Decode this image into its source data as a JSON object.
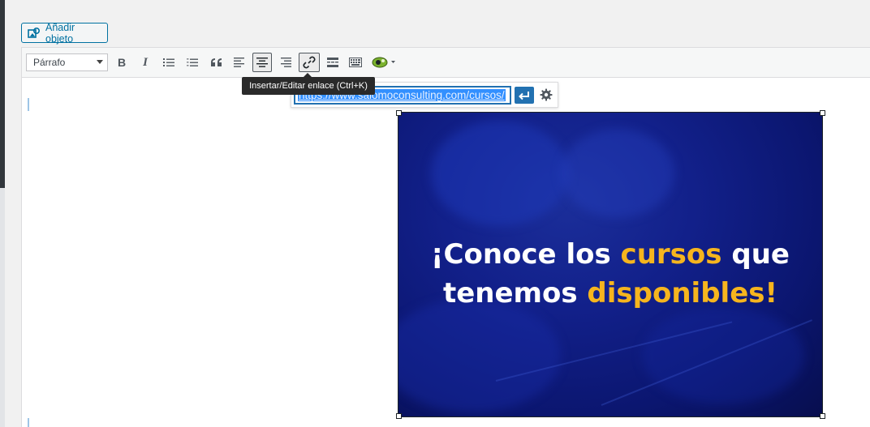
{
  "media": {
    "add_label": "Añadir objeto"
  },
  "toolbar": {
    "format_selected": "Párrafo",
    "bold_label": "B",
    "italic_label": "I"
  },
  "tooltip": {
    "text": "Insertar/Editar enlace (Ctrl+K)"
  },
  "link_popup": {
    "url": "https://www.salomoconsulting.com/cursos/"
  },
  "image": {
    "headline_part1": "¡Conoce los ",
    "headline_highlight1": "cursos",
    "headline_part2": " que tenemos ",
    "headline_highlight2": "disponibles!"
  },
  "colors": {
    "accent": "#2271b1",
    "image_blue": "#12208a",
    "highlight": "#f6b51e"
  }
}
